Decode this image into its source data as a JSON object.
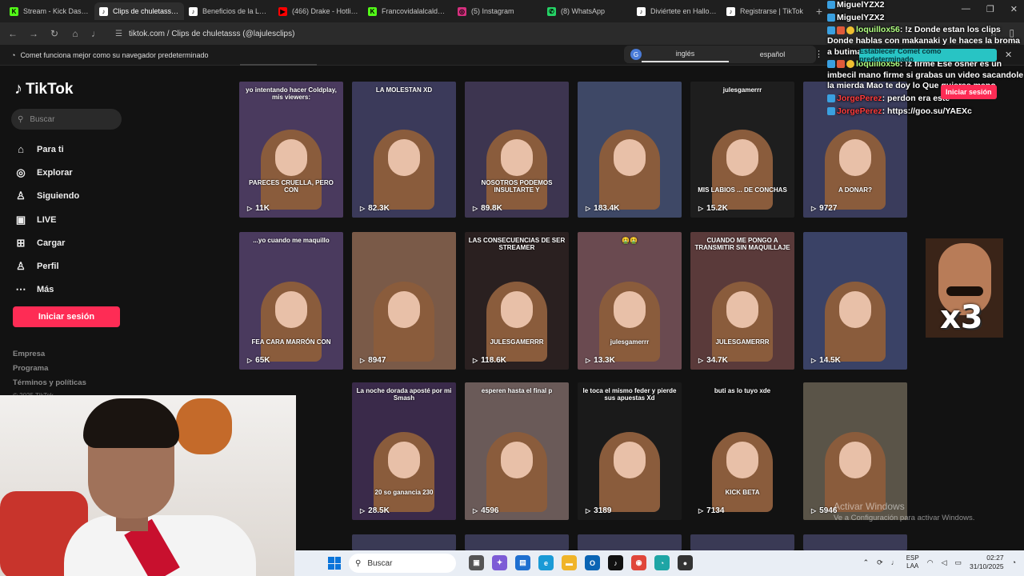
{
  "browser": {
    "tabs": [
      {
        "label": "Stream - Kick Dashbo",
        "icon": "kick-icon",
        "color": "#53fc18",
        "glyph": "K"
      },
      {
        "label": "Clips de chuletass (@",
        "icon": "tiktok-icon",
        "color": "#ffffff",
        "glyph": "♪",
        "active": true
      },
      {
        "label": "Beneficios de la Lactan",
        "icon": "tiktok-icon",
        "color": "#ffffff",
        "glyph": "♪"
      },
      {
        "label": "(466) Drake - Hotline B",
        "icon": "youtube-icon",
        "color": "#ff0000",
        "glyph": "▶"
      },
      {
        "label": "Francovidalalcalde Stre",
        "icon": "kick-icon",
        "color": "#53fc18",
        "glyph": "K"
      },
      {
        "label": "(5) Instagram",
        "icon": "instagram-icon",
        "color": "#d6307f",
        "glyph": "◎"
      },
      {
        "label": "(8) WhatsApp",
        "icon": "whatsapp-icon",
        "color": "#25d366",
        "glyph": "✆"
      },
      {
        "label": "Diviértete en Hallowee",
        "icon": "tiktok-icon",
        "color": "#ffffff",
        "glyph": "♪"
      },
      {
        "label": "Registrarse | TikTok",
        "icon": "tiktok-icon",
        "color": "#ffffff",
        "glyph": "♪"
      }
    ],
    "url": "tiktok.com / Clips de chuletasss (@lajulesclips)",
    "infobar_text": "Comet funciona mejor como su navegador predeterminado",
    "translate": {
      "option1": "inglés",
      "option2": "español"
    },
    "comet_button": "Establecer Comet como predeterminado"
  },
  "tiktok": {
    "logo": "TikTok",
    "search_placeholder": "Buscar",
    "nav": [
      {
        "label": "Para ti",
        "icon": "home-icon",
        "glyph": "⌂"
      },
      {
        "label": "Explorar",
        "icon": "compass-icon",
        "glyph": "◎"
      },
      {
        "label": "Siguiendo",
        "icon": "following-icon",
        "glyph": "♙"
      },
      {
        "label": "LIVE",
        "icon": "live-icon",
        "glyph": "▣"
      },
      {
        "label": "Cargar",
        "icon": "upload-icon",
        "glyph": "⊞"
      },
      {
        "label": "Perfil",
        "icon": "profile-icon",
        "glyph": "♙"
      },
      {
        "label": "Más",
        "icon": "more-icon",
        "glyph": "⋯"
      }
    ],
    "login": "Iniciar sesión",
    "footer": [
      "Empresa",
      "Programa",
      "Términos y políticas"
    ],
    "copyright": "© 2025 TikTok"
  },
  "videos": [
    {
      "views": "11K",
      "caption_top": "yo intentando hacer Coldplay, mis viewers:",
      "caption_mid": "PARECES CRUELLA, PERO CON",
      "bg": "#4a3a5e"
    },
    {
      "views": "82.3K",
      "caption_top": "LA MOLESTAN XD",
      "caption_mid": "",
      "bg": "#3b3a5a"
    },
    {
      "views": "89.8K",
      "caption_top": "",
      "caption_mid": "NOSOTROS PODEMOS INSULTARTE Y",
      "bg": "#3d3550"
    },
    {
      "views": "183.4K",
      "caption_top": "",
      "caption_mid": "",
      "bg": "#3e4866"
    },
    {
      "views": "15.2K",
      "caption_top": "julesgamerrr",
      "caption_mid": "MIS LABIOS ... DE CONCHAS",
      "bg": "#1e1e1e"
    },
    {
      "views": "9727",
      "caption_top": "",
      "caption_mid": "A DONAR?",
      "bg": "#3a3c5c"
    },
    {
      "views": "65K",
      "caption_top": "...yo cuando me maquillo",
      "caption_mid": "FEA CARA MARRÓN CON",
      "bg": "#4a3a5e"
    },
    {
      "views": "8947",
      "caption_top": "",
      "caption_mid": "",
      "bg": "#7a5a48"
    },
    {
      "views": "118.6K",
      "caption_top": "LAS CONSECUENCIAS DE SER STREAMER",
      "caption_mid": "JULESGAMERRR",
      "bg": "#2a2020"
    },
    {
      "views": "13.3K",
      "caption_top": "🤮🤮",
      "caption_mid": "julesgamerrr",
      "bg": "#6a4a50"
    },
    {
      "views": "34.7K",
      "caption_top": "CUANDO ME PONGO A TRANSMITIR SIN MAQUILLAJE",
      "caption_mid": "JULESGAMERRR",
      "bg": "#5a3a3a"
    },
    {
      "views": "14.5K",
      "caption_top": "",
      "caption_mid": "",
      "bg": "#3a4266"
    },
    {
      "views": "",
      "caption_top": "",
      "caption_mid": "",
      "bg": "#4a3858"
    },
    {
      "views": "28.5K",
      "caption_top": "La noche dorada aposté por mi Smash",
      "caption_mid": "20 so ganancia 230",
      "bg": "#3a2a4a"
    },
    {
      "views": "4596",
      "caption_top": "esperen hasta el final p",
      "caption_mid": "",
      "bg": "#6a5a58"
    },
    {
      "views": "3189",
      "caption_top": "le toca el mismo feder y pierde sus apuestas Xd",
      "caption_mid": "",
      "bg": "#1a1a1a"
    },
    {
      "views": "7134",
      "caption_top": "buti as lo tuyo xde",
      "caption_mid": "KICK BETA",
      "bg": "#121212"
    },
    {
      "views": "5946",
      "caption_top": "",
      "caption_mid": "",
      "bg": "#5a5448"
    }
  ],
  "chat": [
    {
      "user": "MiguelYZX2",
      "text": "",
      "color": "#ffffff"
    },
    {
      "user": "MiguelYZX2",
      "text": "",
      "color": "#ffffff"
    },
    {
      "user": "loquillox56",
      "text": ": !z Donde estan los clips Donde hablas con makanaki y le haces la broma a butiman",
      "color": "#b0ff80"
    },
    {
      "user": "loquillox56",
      "text": ": !z firme Ese osner es un imbecil mano firme si grabas un video sacandole la mierda Mao te doy lo Que quieras mano",
      "color": "#b0ff80"
    },
    {
      "user": "JorgePerez",
      "text": ": perdon era este",
      "color": "#ff3b3b"
    },
    {
      "user": "JorgePerez",
      "text": ": https://goo.su/YAEXc",
      "color": "#ff3b3b"
    }
  ],
  "overlay_login": "Iniciar sesión",
  "meme_text": "x3",
  "watermark": {
    "title": "Activar Windows",
    "subtitle": "Ve a Configuración para activar Windows."
  },
  "taskbar": {
    "search": "Buscar",
    "lang": "ESP",
    "lang2": "LAA",
    "time": "02:27",
    "date": "31/10/2025"
  }
}
